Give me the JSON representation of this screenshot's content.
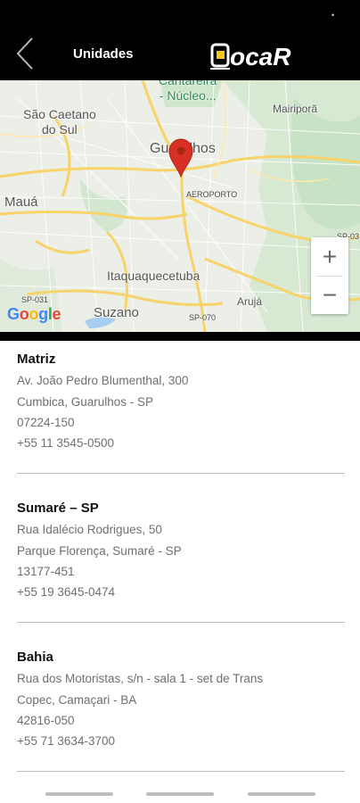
{
  "status_bar": {
    "icon": "signal-icon",
    "glyph": "•"
  },
  "header": {
    "back_icon": "chevron-left-icon",
    "title": "Unidades",
    "logo_text": "LocaR",
    "colors": {
      "background": "#000000",
      "logo_accent": "#f5c518"
    }
  },
  "map": {
    "labels": {
      "cantareira": "Cantareira\n- Núcleo...",
      "sao_caetano": "São Caetano\ndo Sul",
      "guarulhos": "Guarulhos",
      "mairipora": "Mairiporã",
      "maua": "Mauá",
      "aeroporto": "AEROPORTO",
      "itaquaquecetuba": "Itaquaquecetuba",
      "suzano": "Suzano",
      "aruja": "Arujá",
      "sp031": "SP-031",
      "sp070": "SP-070",
      "sp03": "SP-03"
    },
    "zoom_in": "+",
    "zoom_out": "−",
    "attribution": "Google",
    "pin_icon": "map-pin-icon",
    "colors": {
      "pin": "#d93025",
      "roads": "#f7d36a",
      "park": "#c7e2c4"
    }
  },
  "units": [
    {
      "name": "Matriz",
      "address": "Av. João Pedro Blumenthal, 300",
      "city": "Cumbica, Guarulhos - SP",
      "zip": "07224-150",
      "phone": "+55 11 3545-0500"
    },
    {
      "name": "Sumaré – SP",
      "address": "Rua Idalécio Rodrigues, 50",
      "city": "Parque Florença, Sumaré - SP",
      "zip": "13177-451",
      "phone": "+55 19 3645-0474"
    },
    {
      "name": "Bahia",
      "address": "Rua dos Motoristas, s/n - sala 1 - set de Trans",
      "city": "Copec, Camaçari - BA",
      "zip": "42816-050",
      "phone": "+55 71 3634-3700"
    }
  ]
}
